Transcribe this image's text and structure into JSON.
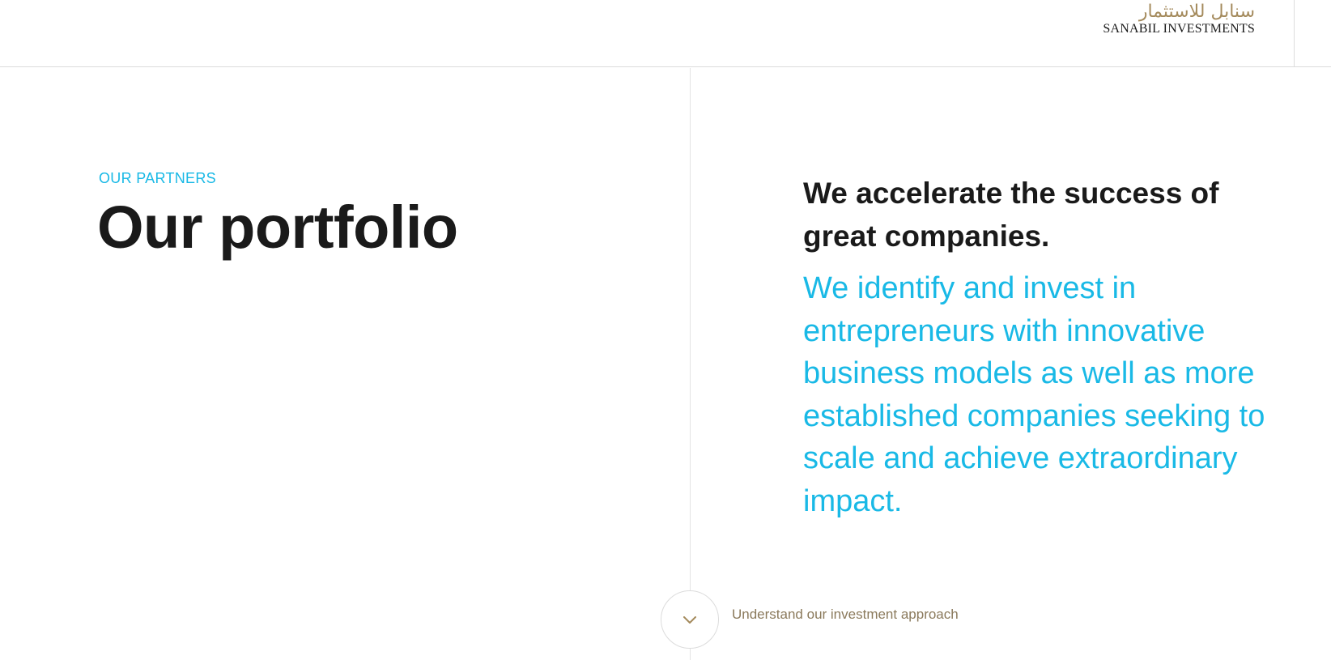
{
  "header": {
    "logo": {
      "arabic_text": "سنابل للاستثمار",
      "latin_text": "SANABIL INVESTMENTS",
      "arabic_color": "#a48a5c"
    }
  },
  "hero": {
    "eyebrow": "OUR PARTNERS",
    "title": "Our portfolio",
    "lead": "We accelerate the success of great companies.",
    "body": "We identify and invest in entrepreneurs with innovative business models as well as more established companies seeking to scale and achieve extraordinary impact."
  },
  "cta": {
    "icon": "chevron-down-icon",
    "label": "Understand our investment approach"
  },
  "colors": {
    "accent_blue": "#19b9e6",
    "gold": "#a48a5c",
    "text_dark": "#1a1a1a",
    "divider": "#dcdcdc"
  }
}
